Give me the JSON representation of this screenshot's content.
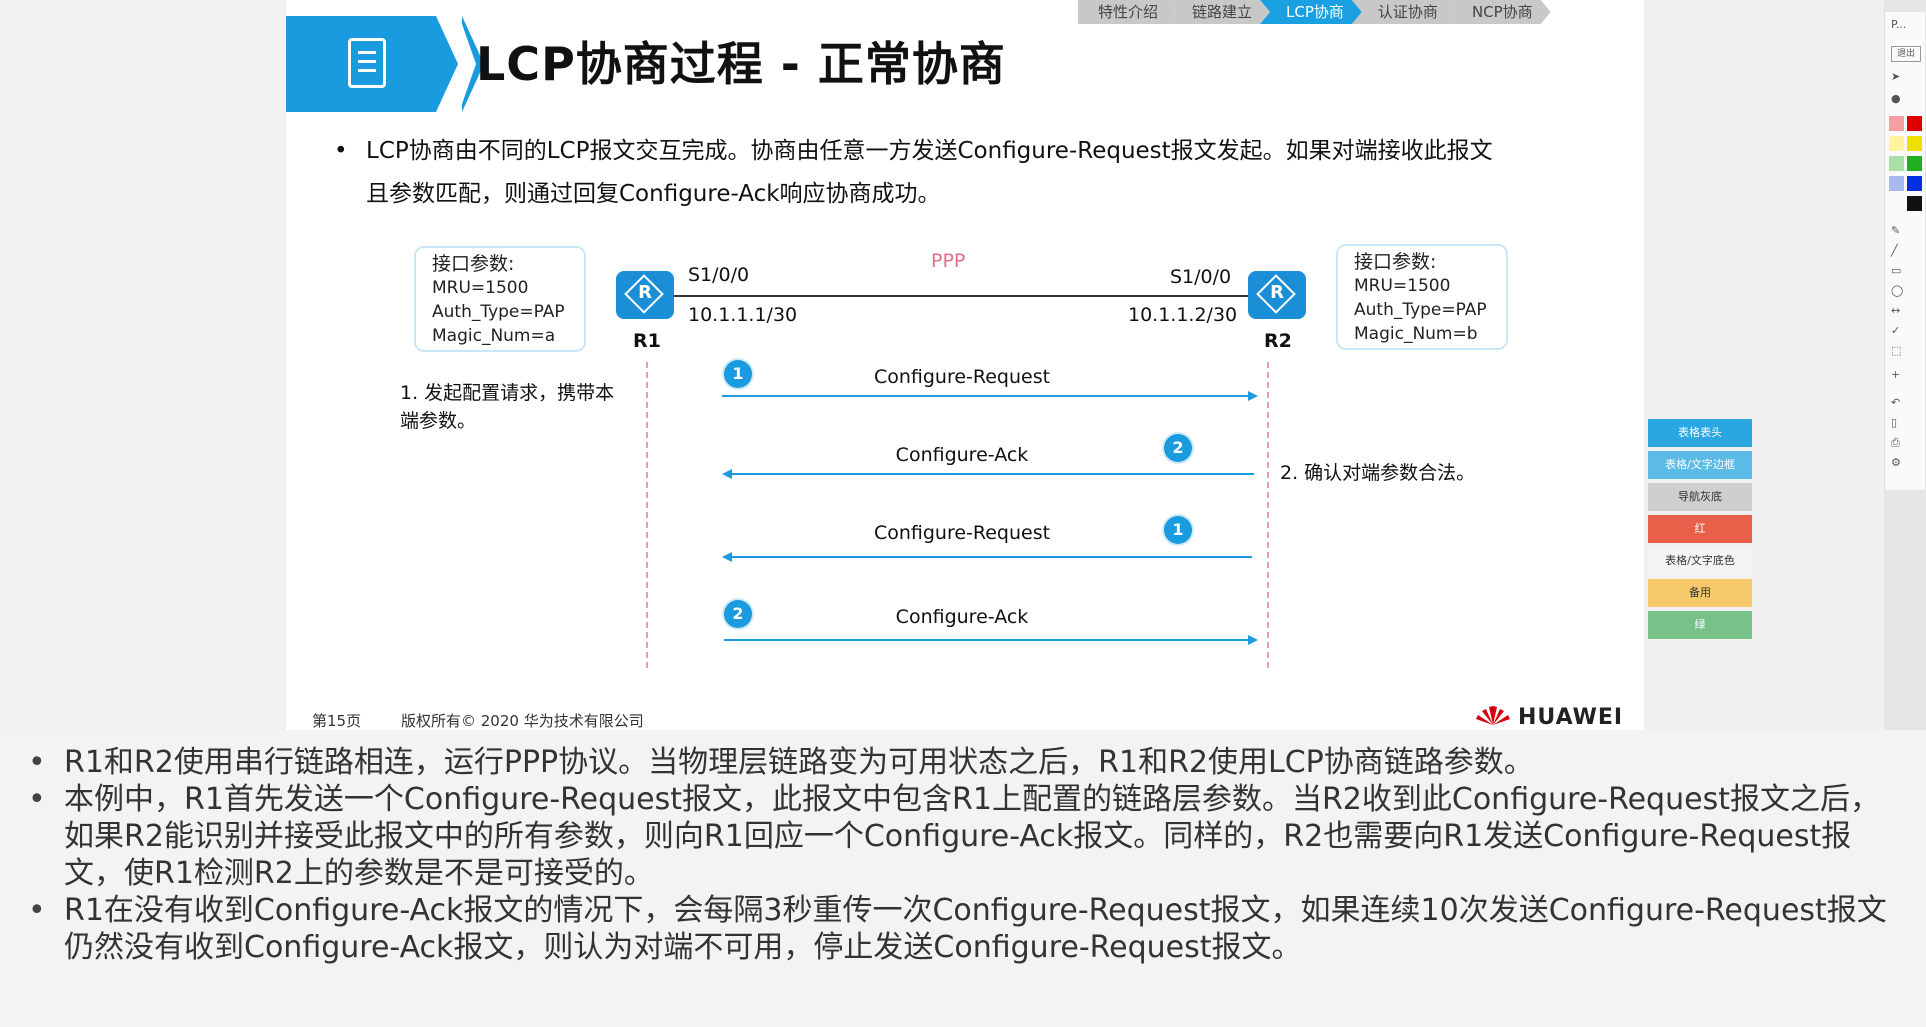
{
  "nav_tabs": [
    {
      "label": "特性介绍",
      "active": false
    },
    {
      "label": "链路建立",
      "active": false
    },
    {
      "label": "LCP协商",
      "active": true
    },
    {
      "label": "认证协商",
      "active": false
    },
    {
      "label": "NCP协商",
      "active": false
    }
  ],
  "slide": {
    "title": "LCP协商过程 - 正常协商",
    "bullet_line1": "LCP协商由不同的LCP报文交互完成。协商由任意一方发送Configure-Request报文发起。如果对端接收此报文",
    "bullet_line2": "且参数匹配，则通过回复Configure-Ack响应协商成功。",
    "r1_params": {
      "header": "接口参数:",
      "mru": "MRU=1500",
      "auth": "Auth_Type=PAP",
      "magic": "Magic_Num=a"
    },
    "r2_params": {
      "header": "接口参数:",
      "mru": "MRU=1500",
      "auth": "Auth_Type=PAP",
      "magic": "Magic_Num=b"
    },
    "link_label": "PPP",
    "r1": {
      "name": "R1",
      "iface": "S1/0/0",
      "ip": "10.1.1.1/30",
      "icon": "R"
    },
    "r2": {
      "name": "R2",
      "iface": "S1/0/0",
      "ip": "10.1.1.2/30",
      "icon": "R"
    },
    "step1_line1": "1. 发起配置请求，携带本",
    "step1_line2": "端参数。",
    "step2": "2. 确认对端参数合法。",
    "messages": [
      {
        "label": "Configure-Request",
        "badge": "1"
      },
      {
        "label": "Configure-Ack",
        "badge": "2"
      },
      {
        "label": "Configure-Request",
        "badge": "1"
      },
      {
        "label": "Configure-Ack",
        "badge": "2"
      }
    ],
    "footer_page": "第15页",
    "footer_copyright": "版权所有© 2020 华为技术有限公司",
    "brand": "HUAWEI"
  },
  "notes": [
    "R1和R2使用串行链路相连，运行PPP协议。当物理层链路变为可用状态之后，R1和R2使用LCP协商链路参数。",
    "本例中，R1首先发送一个Configure-Request报文，此报文中包含R1上配置的链路层参数。当R2收到此Configure-Request报文之后，如果R2能识别并接受此报文中的所有参数，则向R1回应一个Configure-Ack报文。同样的，R2也需要向R1发送Configure-Request报文，使R1检测R2上的参数是不是可接受的。",
    "R1在没有收到Configure-Ack报文的情况下，会每隔3秒重传一次Configure-Request报文，如果连续10次发送Configure-Request报文仍然没有收到Configure-Ack报文，则认为对端不可用，停止发送Configure-Request报文。"
  ],
  "style_panel": [
    {
      "label": "表格表头",
      "color": "#2aa6e0"
    },
    {
      "label": "表格/文字边框",
      "color": "#5cbbe6"
    },
    {
      "label": "导航灰底",
      "color": "#cfcfcf"
    },
    {
      "label": "红",
      "color": "#e8604a"
    },
    {
      "label": "表格/文字底色",
      "color": "#f4f4f4"
    },
    {
      "label": "备用",
      "color": "#f6c96a"
    },
    {
      "label": "绿",
      "color": "#78c28a"
    }
  ],
  "toolbar": {
    "top_label": "P...",
    "button": "退出"
  }
}
